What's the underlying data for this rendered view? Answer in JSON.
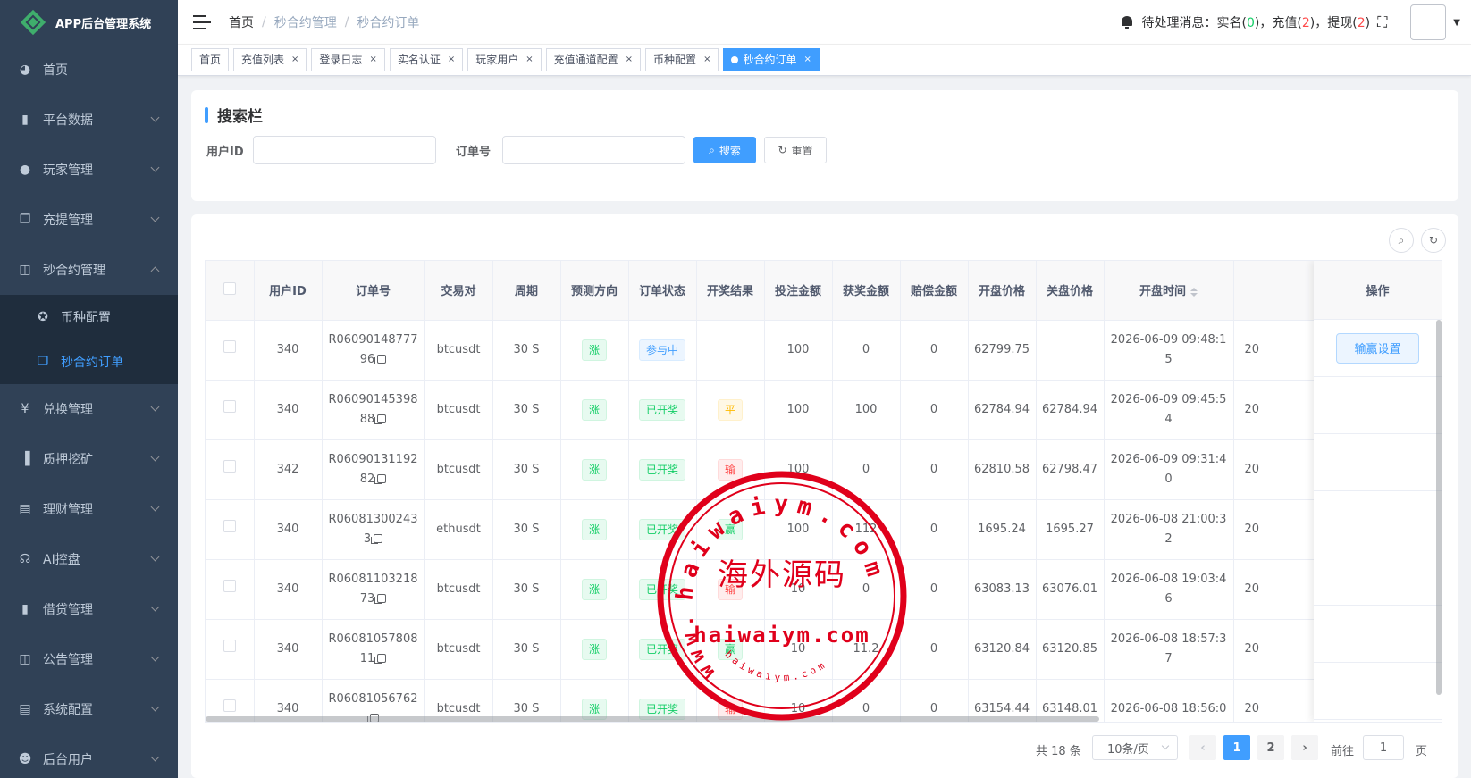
{
  "app": {
    "title": "APP后台管理系统"
  },
  "sidebar": {
    "items": [
      {
        "label": "首页",
        "icon": "dashboard-icon",
        "glyph": "◕"
      },
      {
        "label": "平台数据",
        "icon": "book-icon",
        "glyph": "▮"
      },
      {
        "label": "玩家管理",
        "icon": "user-icon",
        "glyph": "●"
      },
      {
        "label": "充提管理",
        "icon": "copy-icon",
        "glyph": "❐"
      },
      {
        "label": "秒合约管理",
        "icon": "chart-icon",
        "glyph": "◫"
      }
    ],
    "sub_items": [
      {
        "label": "币种配置",
        "icon": "coin-icon",
        "glyph": "✪"
      },
      {
        "label": "秒合约订单",
        "icon": "order-icon",
        "glyph": "❐"
      }
    ],
    "bottom_items": [
      {
        "label": "兑换管理",
        "icon": "yen-icon",
        "glyph": "¥"
      },
      {
        "label": "质押挖矿",
        "icon": "bar-chart-icon",
        "glyph": "▐"
      },
      {
        "label": "理财管理",
        "icon": "document-icon",
        "glyph": "▤"
      },
      {
        "label": "AI控盘",
        "icon": "robot-icon",
        "glyph": "☊"
      },
      {
        "label": "借贷管理",
        "icon": "book-icon",
        "glyph": "▮"
      },
      {
        "label": "公告管理",
        "icon": "open-book-icon",
        "glyph": "◫"
      },
      {
        "label": "系统配置",
        "icon": "document-icon",
        "glyph": "▤"
      },
      {
        "label": "后台用户",
        "icon": "admin-user-icon",
        "glyph": "☻"
      }
    ]
  },
  "navbar": {
    "breadcrumb": [
      "首页",
      "秒合约管理",
      "秒合约订单"
    ],
    "notice": {
      "prefix": "待处理消息：实名",
      "realname_count": "0",
      "recharge_label": "充值",
      "recharge_count": "2",
      "withdraw_label": "提现",
      "withdraw_count": "2"
    }
  },
  "tags": {
    "items": [
      "首页",
      "充值列表",
      "登录日志",
      "实名认证",
      "玩家用户",
      "充值通道配置",
      "币种配置",
      "秒合约订单"
    ],
    "active": "秒合约订单",
    "close_glyph": "×"
  },
  "search": {
    "title": "搜索栏",
    "user_id_label": "用户ID",
    "user_id_value": "",
    "order_no_label": "订单号",
    "order_no_value": "",
    "search_button": "搜索",
    "reset_button": "重置"
  },
  "table": {
    "columns": [
      "用户ID",
      "订单号",
      "交易对",
      "周期",
      "预测方向",
      "订单状态",
      "开奖结果",
      "投注金额",
      "获奖金额",
      "赔偿金额",
      "开盘价格",
      "关盘价格",
      "开盘时间",
      "",
      "操作"
    ],
    "rows": [
      {
        "user_id": "340",
        "order_no_a": "R06090148777",
        "order_no_b": "96",
        "pair": "btcusdt",
        "period": "30 S",
        "direction": "涨",
        "status": "参与中",
        "status_type": "primary",
        "result": "",
        "result_type": "",
        "bet": "100",
        "win": "0",
        "comp": "0",
        "open_price": "62799.75",
        "close_price": "",
        "open_time_a": "2026-06-09 09:48:1",
        "open_time_b": "5",
        "next": "20"
      },
      {
        "user_id": "340",
        "order_no_a": "R06090145398",
        "order_no_b": "88",
        "pair": "btcusdt",
        "period": "30 S",
        "direction": "涨",
        "status": "已开奖",
        "status_type": "success",
        "result": "平",
        "result_type": "warning",
        "bet": "100",
        "win": "100",
        "comp": "0",
        "open_price": "62784.94",
        "close_price": "62784.94",
        "open_time_a": "2026-06-09 09:45:5",
        "open_time_b": "4",
        "next": "20"
      },
      {
        "user_id": "342",
        "order_no_a": "R06090131192",
        "order_no_b": "82",
        "pair": "btcusdt",
        "period": "30 S",
        "direction": "涨",
        "status": "已开奖",
        "status_type": "success",
        "result": "输",
        "result_type": "danger",
        "bet": "100",
        "win": "0",
        "comp": "0",
        "open_price": "62810.58",
        "close_price": "62798.47",
        "open_time_a": "2026-06-09 09:31:4",
        "open_time_b": "0",
        "next": "20"
      },
      {
        "user_id": "340",
        "order_no_a": "R06081300243",
        "order_no_b": "3",
        "pair": "ethusdt",
        "period": "30 S",
        "direction": "涨",
        "status": "已开奖",
        "status_type": "success",
        "result": "赢",
        "result_type": "success",
        "bet": "100",
        "win": "112",
        "comp": "0",
        "open_price": "1695.24",
        "close_price": "1695.27",
        "open_time_a": "2026-06-08 21:00:3",
        "open_time_b": "2",
        "next": "20"
      },
      {
        "user_id": "340",
        "order_no_a": "R06081103218",
        "order_no_b": "73",
        "pair": "btcusdt",
        "period": "30 S",
        "direction": "涨",
        "status": "已开奖",
        "status_type": "success",
        "result": "输",
        "result_type": "danger",
        "bet": "10",
        "win": "0",
        "comp": "0",
        "open_price": "63083.13",
        "close_price": "63076.01",
        "open_time_a": "2026-06-08 19:03:4",
        "open_time_b": "6",
        "next": "20"
      },
      {
        "user_id": "340",
        "order_no_a": "R06081057808",
        "order_no_b": "11",
        "pair": "btcusdt",
        "period": "30 S",
        "direction": "涨",
        "status": "已开奖",
        "status_type": "success",
        "result": "赢",
        "result_type": "success",
        "bet": "10",
        "win": "11.2",
        "comp": "0",
        "open_price": "63120.84",
        "close_price": "63120.85",
        "open_time_a": "2026-06-08 18:57:3",
        "open_time_b": "7",
        "next": "20"
      },
      {
        "user_id": "340",
        "order_no_a": "R06081056762",
        "order_no_b": "",
        "pair": "btcusdt",
        "period": "30 S",
        "direction": "涨",
        "status": "已开奖",
        "status_type": "success",
        "result": "输",
        "result_type": "danger",
        "bet": "10",
        "win": "0",
        "comp": "0",
        "open_price": "63154.44",
        "close_price": "63148.01",
        "open_time_a": "2026-06-08 18:56:0",
        "open_time_b": "",
        "next": "20"
      }
    ],
    "op_header": "操作",
    "op_button": "输赢设置"
  },
  "pagination": {
    "total": "共 18 条",
    "page_size": "10条/页",
    "pages": [
      "1",
      "2"
    ],
    "current": "1",
    "goto_label": "前往",
    "goto_value": "1",
    "page_suffix": "页"
  },
  "watermark": {
    "arc_text": "haiwaiym.com",
    "arc_text_left": "www.",
    "center_text": "海外源码",
    "bottom_text": "haiwaiym.com",
    "bottom_arc": "haiwaiym.com",
    "color": "#e0001b"
  },
  "colors": {
    "sidebar_bg": "#304156",
    "submenu_bg": "#1f2d3d",
    "primary": "#409eff",
    "success": "#13ce66",
    "danger": "#ff4949",
    "warning": "#ffba00",
    "logo_green": "#3fae6c"
  }
}
